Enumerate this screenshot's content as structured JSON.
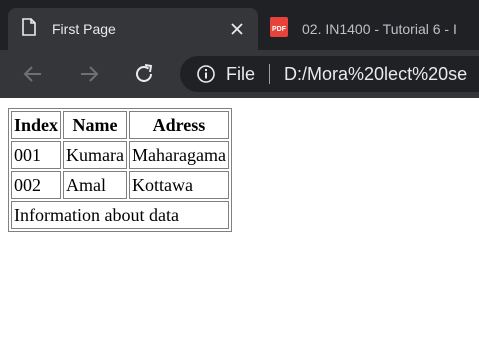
{
  "browser": {
    "tabs": [
      {
        "title": "First Page",
        "active": true
      },
      {
        "title": "02. IN1400 - Tutorial 6 - I",
        "active": false
      }
    ],
    "address_bar": {
      "scheme_label": "File",
      "url": "D:/Mora%20lect%20se"
    },
    "icons": [
      "document-icon",
      "close-icon",
      "pdf-icon",
      "back-arrow-icon",
      "forward-arrow-icon",
      "reload-icon",
      "info-icon"
    ],
    "colors": {
      "tabstrip": "#202124",
      "toolbar": "#35363a",
      "pdf_icon": "#e8433a"
    }
  },
  "page": {
    "table": {
      "headers": [
        "Index",
        "Name",
        "Adress"
      ],
      "rows": [
        [
          "001",
          "Kumara",
          "Maharagama"
        ],
        [
          "002",
          "Amal",
          "Kottawa"
        ]
      ],
      "footer": "Information about data"
    }
  }
}
